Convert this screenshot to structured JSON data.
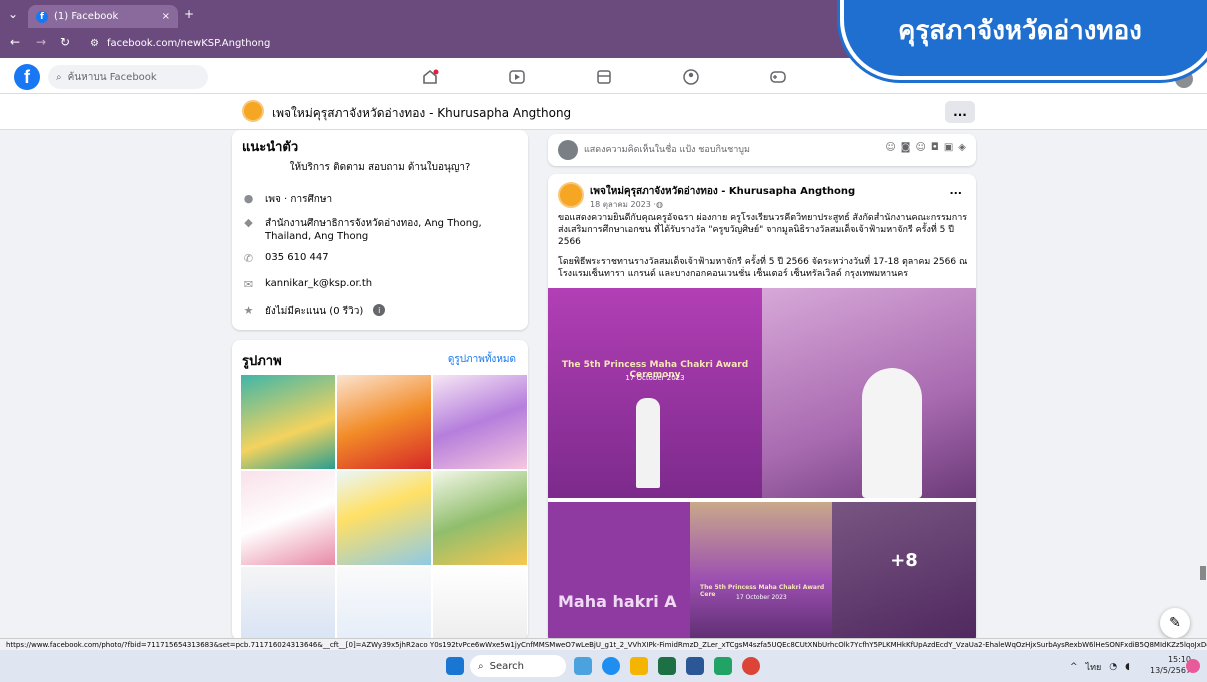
{
  "browser": {
    "tab_title": "(1) Facebook",
    "tab_close": "×",
    "new_tab": "+",
    "url": "facebook.com/newKSP.Angthong"
  },
  "fb_nav": {
    "logo": "f",
    "search_placeholder": "ค้นหาบน Facebook"
  },
  "overlay": {
    "bubble_text": "คุรุสภาจังหวัดอ่างทอง"
  },
  "page_header": {
    "name": "เพจใหม่คุรุสภาจังหวัดอ่างทอง - Khurusapha Angthong",
    "more": "..."
  },
  "intro": {
    "title": "แนะนำตัว",
    "bio": "ให้บริการ ติดตาม สอบถาม ด้านใบอนุญา?",
    "category": "เพจ · การศึกษา",
    "address": "สำนักงานศึกษาธิการจังหวัดอ่างทอง, Ang Thong, Thailand, Ang Thong",
    "phone": "035 610 447",
    "email": "kannikar_k@ksp.or.th",
    "rating": "ยังไม่มีคะแนน (0 รีวิว)"
  },
  "photos": {
    "title": "รูปภาพ",
    "see_all": "ดูรูปภาพทั้งหมด"
  },
  "composer": {
    "placeholder": "แสดงความคิดเห็นในชื่อ แป้ง ชอบกินชาบูม"
  },
  "post": {
    "author": "เพจใหม่คุรุสภาจังหวัดอ่างทอง - Khurusapha Angthong",
    "time": "18 ตุลาคม 2023 · ",
    "more": "...",
    "para1": "ขอแสดงความยินดีกับคุณครูอัจฉรา ผ่องกาย ครูโรงเรียนวรคีตวิทยาประสูทธ์ สังกัดสำนักงานคณะกรรมการส่งเสริมการศึกษาเอกชน ที่ได้รับรางวัล \"ครูขวัญศิษย์\" จากมูลนิธิรางวัลสมเด็จเจ้าฟ้ามหาจักรี ครั้งที่ 5 ปี 2566",
    "para2": "โดยพิธีพระราชทานรางวัลสมเด็จเจ้าฟ้ามหาจักรี ครั้งที่ 5 ปี 2566 จัดระหว่างวันที่ 17-18 ตุลาคม 2566 ณ โรงแรมเซ็นทารา แกรนด์ และบางกอกคอนเวนชั่น เซ็นเตอร์ เซ็นทรัลเวิลด์ กรุงเทพมหานคร",
    "photo1_caption": "The 5th Princess Maha Chakri Award Ceremony",
    "photo1_date": "17 October 2023",
    "photo3_text": "Maha hakri A",
    "photo4_caption": "The 5th Princess Maha Chakri Award Cere",
    "photo4_date": "17 October 2023",
    "more_count": "+8"
  },
  "status_url": "https://www.facebook.com/photo/?fbid=711715654313683&set=pcb.711716024313646&__cft__[0]=AZWy39x5jhR2aco Y0s192tvPce6wWxe5w1jyCnfMMSMweO7wLeBjU_g1t_2_VVhXIPk-FimidRmzD_ZLer_xTCgsM4szfa5UQEc8CUtXNbUrhcOlk7YcfhY5PLKMHkKfUpAzdEcdY_VzaUa2-EhaleWqOzHjxSurbAysRexbW6lHeSONFxdiB5Q8MIdKZz5lqoJxDgfFm9a3X...",
  "taskbar": {
    "search": "Search",
    "lang": "ไทย",
    "time": "15:10",
    "date": "13/5/2567"
  },
  "colors": {
    "chrome": "#6b4a7e",
    "fb_blue": "#1877f2",
    "bubble": "#1f6fd1"
  }
}
